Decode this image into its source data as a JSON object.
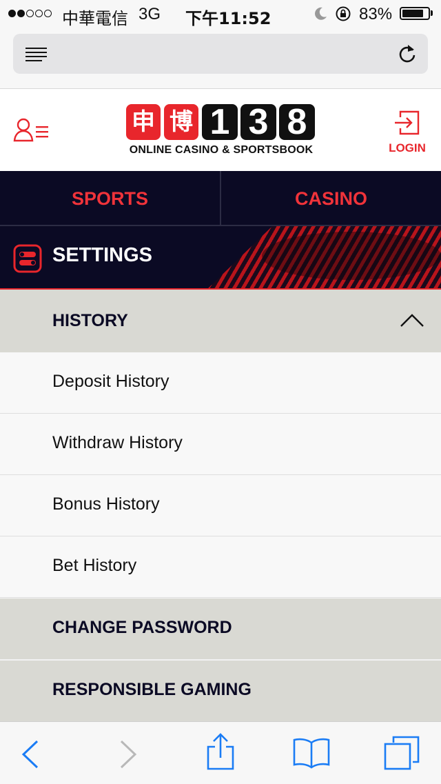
{
  "status_bar": {
    "carrier": "中華電信",
    "network": "3G",
    "time": "下午11:52",
    "battery": "83%",
    "battery_level": 0.83
  },
  "header": {
    "logo_chinese_1": "申",
    "logo_chinese_2": "博",
    "logo_digit_1": "1",
    "logo_digit_2": "3",
    "logo_digit_3": "8",
    "tagline": "ONLINE CASINO & SPORTSBOOK",
    "login_label": "LOGIN",
    "accent_color": "#e8262c"
  },
  "nav": {
    "sports_label": "SPORTS",
    "casino_label": "CASINO"
  },
  "settings": {
    "title": "SETTINGS"
  },
  "menu": {
    "history_label": "HISTORY",
    "history_items": [
      "Deposit History",
      "Withdraw History",
      "Bonus History",
      "Bet History"
    ],
    "change_password_label": "CHANGE PASSWORD",
    "responsible_gaming_label": "RESPONSIBLE GAMING"
  },
  "icons": {
    "menu": "reader-lines-icon",
    "reload": "reload-icon",
    "account": "account-menu-icon",
    "login": "login-icon",
    "settings": "settings-toggle-icon",
    "collapse": "chevron-up-icon",
    "back": "back-arrow-icon",
    "forward": "forward-arrow-icon",
    "share": "share-icon",
    "bookmarks": "bookmarks-icon",
    "tabs": "tabs-icon"
  }
}
